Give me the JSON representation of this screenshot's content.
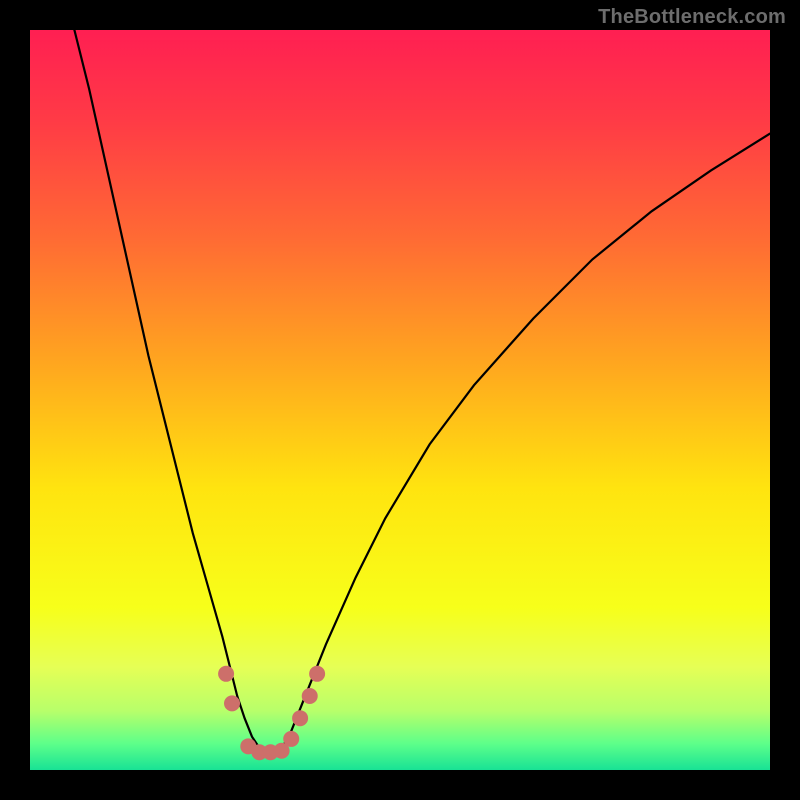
{
  "watermark": "TheBottleneck.com",
  "colors": {
    "frame": "#000000",
    "curve": "#000000",
    "markers": "#cd6f6a",
    "gradient_stops": [
      {
        "offset": 0.0,
        "color": "#ff1f52"
      },
      {
        "offset": 0.12,
        "color": "#ff3a46"
      },
      {
        "offset": 0.28,
        "color": "#ff6a34"
      },
      {
        "offset": 0.45,
        "color": "#ffa61f"
      },
      {
        "offset": 0.62,
        "color": "#ffe40f"
      },
      {
        "offset": 0.78,
        "color": "#f7ff1a"
      },
      {
        "offset": 0.86,
        "color": "#e6ff55"
      },
      {
        "offset": 0.92,
        "color": "#b8ff6a"
      },
      {
        "offset": 0.965,
        "color": "#5cff8a"
      },
      {
        "offset": 1.0,
        "color": "#18e295"
      }
    ]
  },
  "chart_data": {
    "type": "line",
    "title": "",
    "xlabel": "",
    "ylabel": "",
    "xlim": [
      0,
      100
    ],
    "ylim": [
      0,
      100
    ],
    "axes_hidden": true,
    "series": [
      {
        "name": "bottleneck-curve",
        "x": [
          6,
          8,
          10,
          12,
          14,
          16,
          18,
          20,
          22,
          24,
          26,
          27,
          28,
          29,
          30,
          31,
          32,
          33,
          34,
          35,
          36,
          38,
          40,
          44,
          48,
          54,
          60,
          68,
          76,
          84,
          92,
          100
        ],
        "y": [
          100,
          92,
          83,
          74,
          65,
          56,
          48,
          40,
          32,
          25,
          18,
          14,
          10,
          7,
          4.5,
          3,
          2.3,
          2.3,
          3,
          4.5,
          7,
          12,
          17,
          26,
          34,
          44,
          52,
          61,
          69,
          75.5,
          81,
          86
        ]
      }
    ],
    "markers": [
      {
        "x": 26.5,
        "y": 13
      },
      {
        "x": 27.3,
        "y": 9
      },
      {
        "x": 29.5,
        "y": 3.2
      },
      {
        "x": 31.0,
        "y": 2.4
      },
      {
        "x": 32.5,
        "y": 2.4
      },
      {
        "x": 34.0,
        "y": 2.6
      },
      {
        "x": 35.3,
        "y": 4.2
      },
      {
        "x": 36.5,
        "y": 7.0
      },
      {
        "x": 37.8,
        "y": 10.0
      },
      {
        "x": 38.8,
        "y": 13.0
      }
    ],
    "marker_radius_px": 8
  }
}
